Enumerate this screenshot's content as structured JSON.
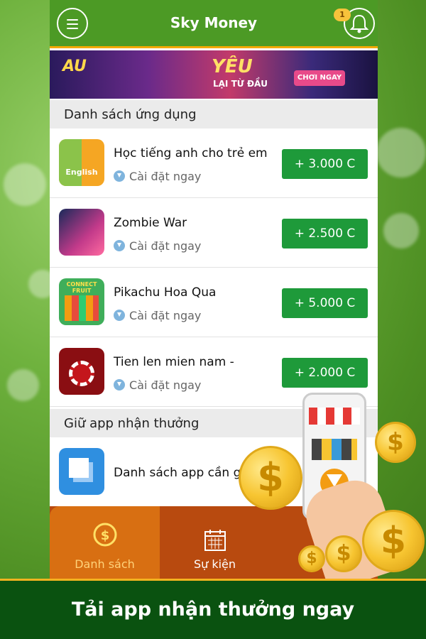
{
  "header": {
    "title": "Sky Money",
    "notification_count": "1"
  },
  "banner": {
    "logo_text": "AU",
    "headline": "YÊU",
    "subline": "LẠI TỪ ĐẦU",
    "cta": "CHƠI NGAY"
  },
  "sections": {
    "apps_title": "Danh sách ứng dụng",
    "keep_title": "Giữ app nhận thưởng"
  },
  "apps": [
    {
      "name": "Học tiếng anh cho trẻ em",
      "action": "Cài đặt ngay",
      "reward": "+ 3.000 C",
      "icon_text": "English"
    },
    {
      "name": "Zombie War",
      "action": "Cài đặt ngay",
      "reward": "+ 2.500 C"
    },
    {
      "name": "Pikachu Hoa Qua",
      "action": "Cài đặt ngay",
      "reward": "+ 5.000 C",
      "icon_text": "CONNECT FRUIT"
    },
    {
      "name": "Tien len mien nam -",
      "action": "Cài đặt ngay",
      "reward": "+ 2.000 C"
    }
  ],
  "keep_item": {
    "name": "Danh sách app cần giữ"
  },
  "tabs": [
    {
      "label": "Danh sách"
    },
    {
      "label": "Sự kiện"
    }
  ],
  "footer": {
    "text": "Tải app nhận thưởng ngay"
  },
  "colors": {
    "accent_green": "#4c9a25",
    "reward_green": "#1e9a3a",
    "tab_orange": "#d86f12",
    "footer_green": "#0a5210",
    "coin_gold": "#f7c531"
  }
}
